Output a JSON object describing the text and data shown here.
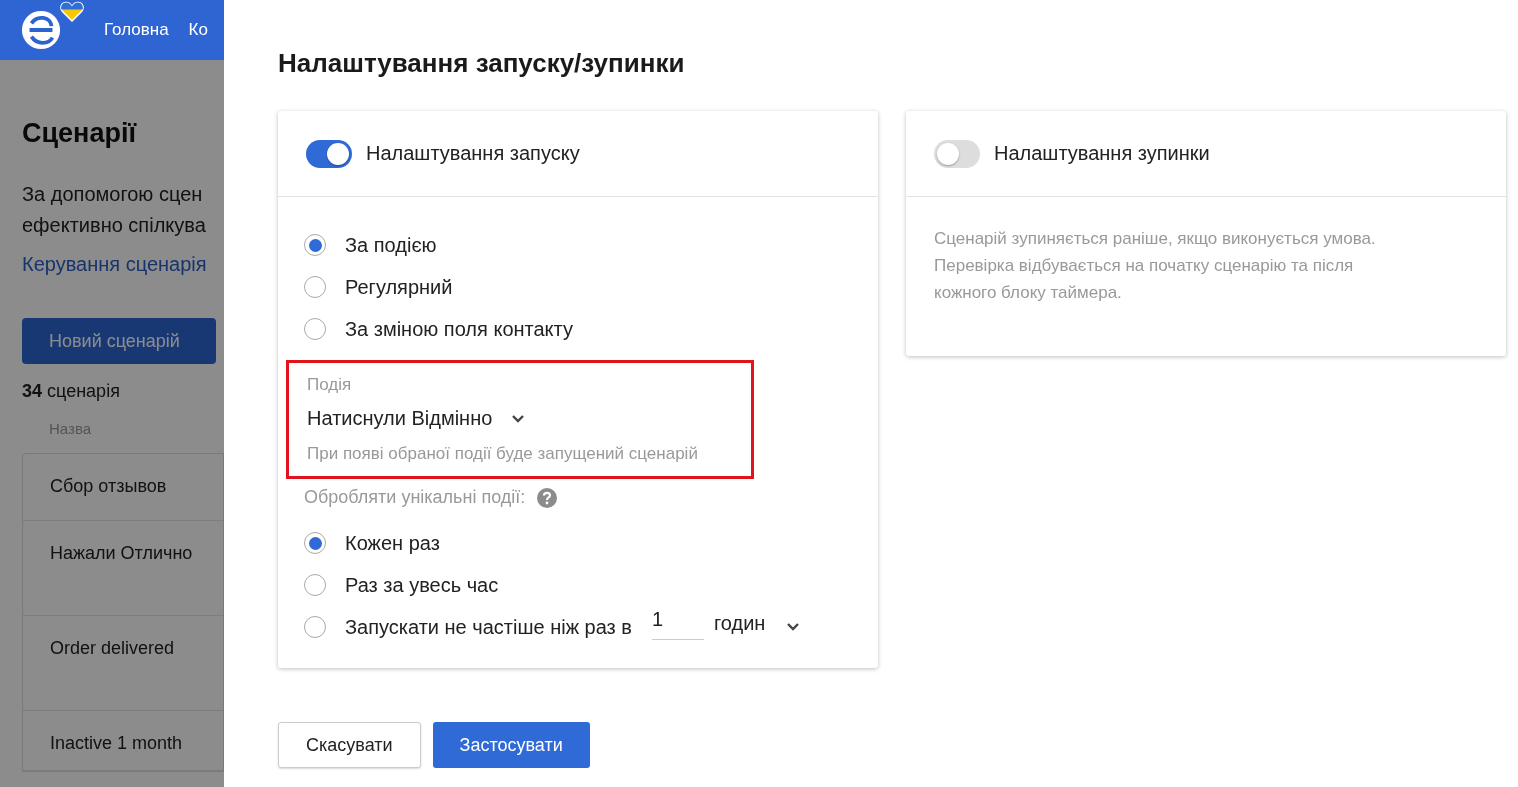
{
  "background_page": {
    "nav": [
      {
        "label": "Головна"
      },
      {
        "label": "Ко"
      }
    ],
    "title": "Сценарії",
    "description_lines": [
      "За допомогою сцен",
      "ефективно спілкува"
    ],
    "link": "Керування сценарія",
    "new_button": "Новий сценарій",
    "count": "34",
    "count_label": "сценарія",
    "column_header": "Назва",
    "rows": [
      "Сбор отзывов",
      "Нажали Отлично",
      "Order delivered",
      "Inactive 1 month"
    ]
  },
  "drawer": {
    "title": "Налаштування запуску/зупинки",
    "start_card": {
      "toggle": {
        "label": "Налаштування запуску",
        "on": true
      },
      "trigger_options": [
        {
          "label": "За подією",
          "selected": true
        },
        {
          "label": "Регулярний",
          "selected": false
        },
        {
          "label": "За зміною поля контакту",
          "selected": false
        }
      ],
      "event_field": {
        "label": "Подія",
        "value": "Натиснули Відмінно",
        "hint": "При появі обраної події буде запущений сценарій",
        "highlighted": true
      },
      "unique_label": "Обробляти унікальні події:",
      "unique_options": [
        {
          "kind": "plain",
          "label": "Кожен раз",
          "selected": true
        },
        {
          "kind": "plain",
          "label": "Раз за увесь час",
          "selected": false
        },
        {
          "kind": "interval",
          "label": "Запускати не частіше ніж раз в",
          "value": "1",
          "unit": "годин",
          "selected": false
        }
      ]
    },
    "stop_card": {
      "toggle": {
        "label": "Налаштування зупинки",
        "on": false
      },
      "description": "Сценарій зупиняється раніше, якщо виконується умова. Перевірка відбувається на початку сценарію та після кожного блоку таймера."
    },
    "buttons": [
      {
        "label": "Скасувати",
        "kind": "secondary"
      },
      {
        "label": "Застосувати",
        "kind": "primary"
      }
    ]
  }
}
